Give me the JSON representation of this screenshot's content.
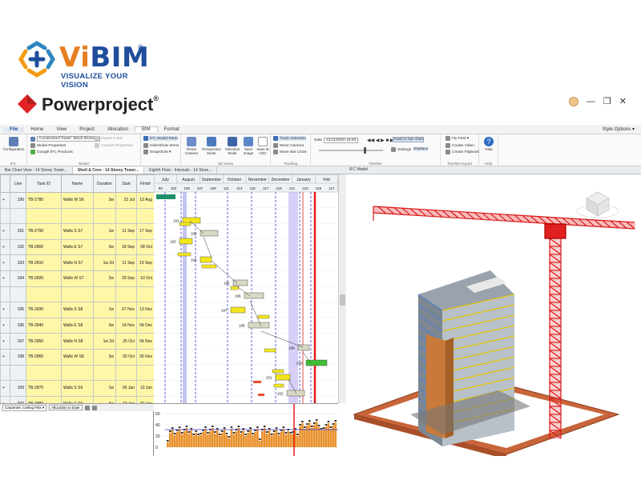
{
  "branding": {
    "vibim_name_part1": "Vi",
    "vibim_name_part2": "BIM",
    "vibim_reg": "®",
    "vibim_tagline": "VISUALIZE YOUR VISION",
    "pp_name": "Powerproject",
    "pp_tm": "®"
  },
  "ribbon": {
    "tabs": [
      "File",
      "Home",
      "View",
      "Project",
      "Allocation",
      "BIM",
      "Format"
    ],
    "style_options": "Style Options ▾",
    "configuration": "Configuration",
    "model_combo": "Constrained Tower: Block Revised",
    "model_properties": "Model Properties",
    "google_ifc": "Google IFC Products",
    "import_costs": "Import Costs",
    "custom_properties": "Custom Properties",
    "ifc_model_pane": "IFC Model Pane",
    "hide_show_items": "Hide/Show Items",
    "snapshots": "Snapshots ▾",
    "reset_camera": "Reset Camera",
    "perspective_mode": "Perspective Mode",
    "selection_mode": "Selection Mode",
    "save_image": "Save Image",
    "save_to_ozc": "Save at OZC",
    "track_selection": "Track Selection",
    "move_camera": "Move Camera",
    "move_bar_chart": "Move Bar Chart",
    "date_label": "Date",
    "date_value": "21/11/2020 18:00",
    "track_in_bar_chart": "Track in bar chart",
    "settings": "Settings",
    "displace": "Displace",
    "fly_past": "Fly Past ▾",
    "create_video": "Create Video",
    "create_flipbook": "Create Flipbook",
    "help": "Help",
    "groups": [
      "IFC",
      "Model",
      "3D Views",
      "Tracking",
      "Timeline",
      "Timeline Export",
      "Help"
    ]
  },
  "doc_tabs": [
    "Bar Chart View - 14 Storey Tower...",
    "Shell & Core - 14 Storey Tower...",
    "Eighth Floor - Internals - 14 Store..."
  ],
  "ifc_title": "IFC Model",
  "grid": {
    "headers": [
      "Line",
      "Task ID",
      "Name",
      "Duration",
      "Start",
      "Finish"
    ],
    "rows": [
      {
        "line": "190",
        "id": "TB-2780",
        "name": "Walls W S6",
        "dur": "3w",
        "start": "23 Jul",
        "finish": "12 Aug"
      },
      {
        "line": "",
        "id": "",
        "name": "",
        "dur": "",
        "start": "",
        "finish": ""
      },
      {
        "line": "191",
        "id": "TB-2790",
        "name": "Walls S S7",
        "dur": "1w",
        "start": "11 Sep",
        "finish": "17 Sep"
      },
      {
        "line": "192",
        "id": "TB-2800",
        "name": "Walls E S7",
        "dur": "3w",
        "start": "18 Sep",
        "finish": "08 Oct"
      },
      {
        "line": "193",
        "id": "TB-2810",
        "name": "Walls N S7",
        "dur": "1w 2d",
        "start": "11 Sep",
        "finish": "19 Sep"
      },
      {
        "line": "194",
        "id": "TB-2820",
        "name": "Walls W S7",
        "dur": "2w",
        "start": "29 Sep",
        "finish": "10 Oct"
      },
      {
        "line": "",
        "id": "",
        "name": "",
        "dur": "",
        "start": "",
        "finish": ""
      },
      {
        "line": "195",
        "id": "TB-2830",
        "name": "Walls S S8",
        "dur": "1w",
        "start": "07 Nov",
        "finish": "13 Nov"
      },
      {
        "line": "196",
        "id": "TB-2840",
        "name": "Walls E S8",
        "dur": "3w",
        "start": "14 Nov",
        "finish": "04 Dec"
      },
      {
        "line": "197",
        "id": "TB-2850",
        "name": "Walls N S8",
        "dur": "1w 2d",
        "start": "25 Oct",
        "finish": "04 Nov"
      },
      {
        "line": "198",
        "id": "TB-2860",
        "name": "Walls W S8",
        "dur": "3w",
        "start": "05 Oct",
        "finish": "26 Nov"
      },
      {
        "line": "",
        "id": "",
        "name": "",
        "dur": "",
        "start": "",
        "finish": ""
      },
      {
        "line": "199",
        "id": "TB-2870",
        "name": "Walls S S9",
        "dur": "1w",
        "start": "06 Jan",
        "finish": "10 Jan"
      },
      {
        "line": "200",
        "id": "TB-2880",
        "name": "Walls E S9",
        "dur": "3w",
        "start": "13 Jan",
        "finish": "31 Jan"
      },
      {
        "line": "201",
        "id": "TB-2890",
        "name": "Walls N S9",
        "dur": "1w 2d",
        "start": "12 Dec",
        "finish": "20 Dec"
      },
      {
        "line": "202",
        "id": "TB-2900",
        "name": "Walls W S9",
        "dur": "3w",
        "start": "19 Dec",
        "finish": "22 Jan"
      }
    ]
  },
  "gantt": {
    "months": [
      "July",
      "August",
      "September",
      "October",
      "November",
      "December",
      "January",
      "Feb"
    ],
    "weeks": [
      "99",
      "102",
      "105",
      "107",
      "109",
      "111",
      "113",
      "115",
      "117",
      "119",
      "121",
      "123",
      "125",
      "127"
    ],
    "bar_labels": [
      "191",
      "192",
      "193",
      "194",
      "195",
      "196",
      "197",
      "198",
      "199",
      "200",
      "201",
      "202"
    ]
  },
  "histogram": {
    "resource_combo": "Carpenter, Ceiling Fitts ▾",
    "allocation_combo": "Allocation to Date",
    "y_ticks": [
      "60",
      "40",
      "20",
      "0"
    ]
  },
  "colors": {
    "accent_blue": "#1f4e9c",
    "accent_orange": "#e67e22",
    "crane_red": "#e02020",
    "progress_line": "#e31b1b",
    "grid_yellow": "#fff7a8"
  },
  "icons": [
    "user-avatar-icon",
    "minimize-icon",
    "restore-icon",
    "close-icon",
    "settings-icon",
    "help-icon"
  ]
}
